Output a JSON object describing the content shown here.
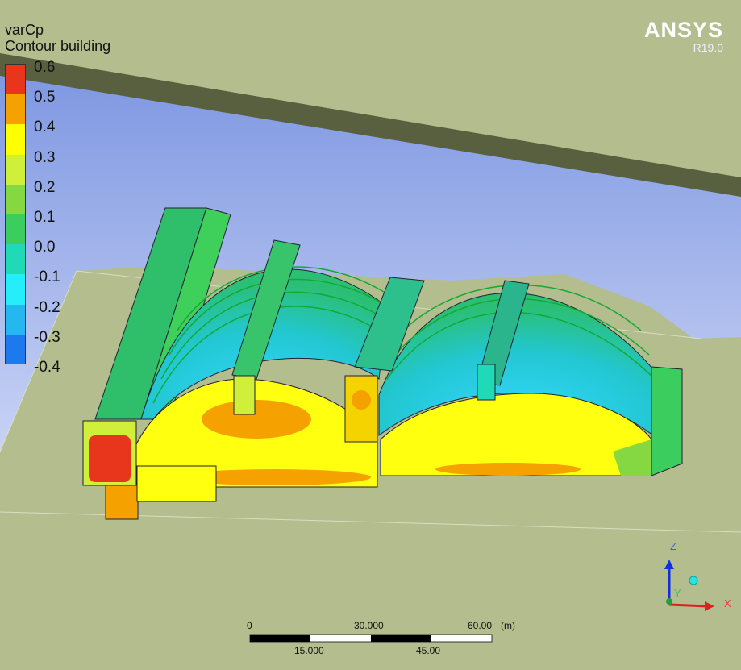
{
  "legend": {
    "variable": "varCp",
    "name": "Contour building",
    "ticks": [
      "0.6",
      "0.5",
      "0.4",
      "0.3",
      "0.2",
      "0.1",
      "0.0",
      "-0.1",
      "-0.2",
      "-0.3",
      "-0.4"
    ],
    "colors": [
      "#e8361d",
      "#f5a200",
      "#ffff00",
      "#cfef3a",
      "#86d842",
      "#3ccd5f",
      "#1fd9b7",
      "#23eefa",
      "#25b7f0",
      "#1e78ee",
      "#1e3ee0"
    ]
  },
  "brand": {
    "name": "ANSYS",
    "version": "R19.0"
  },
  "scale": {
    "top_labels": [
      "0",
      "30.000",
      "60.00"
    ],
    "unit": "(m)",
    "bottom_labels": [
      "15.000",
      "45.00"
    ]
  },
  "axes": {
    "z": "Z",
    "y": "Y",
    "x": "X"
  },
  "colors": {
    "ground": "#b3bd8d",
    "sky_top": "#7f98e2",
    "sky_bottom": "#c9d3f5",
    "roof_band": "#59603f"
  }
}
